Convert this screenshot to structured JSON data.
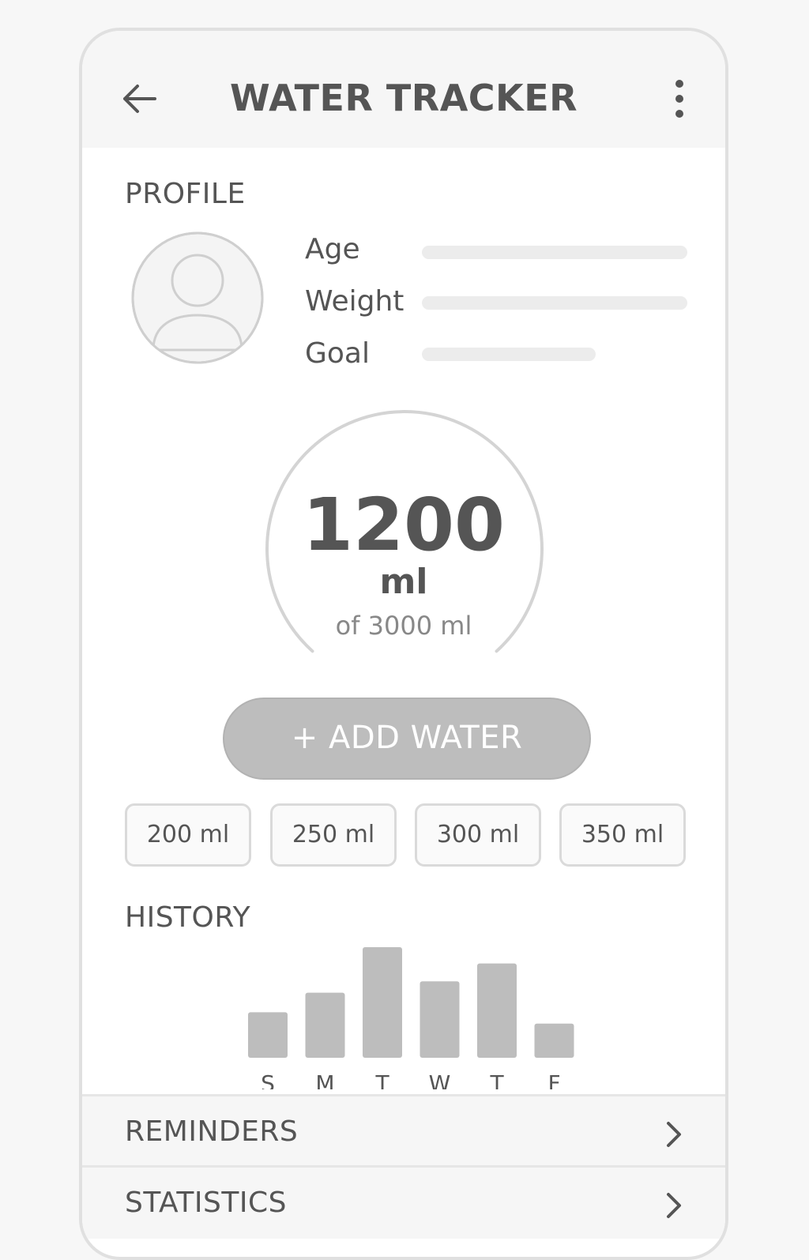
{
  "header": {
    "title": "WATER TRACKER",
    "back_icon": "arrow-left-icon",
    "menu_icon": "more-vertical-icon"
  },
  "profile": {
    "label": "PROFILE",
    "avatar_icon": "user-avatar-icon",
    "fields": [
      {
        "label": "Age"
      },
      {
        "label": "Weight"
      },
      {
        "label": "Goal"
      }
    ]
  },
  "intake": {
    "value": "1200",
    "unit": "ml",
    "goal_text": "of 3000 ml"
  },
  "add_button": {
    "label": "+ ADD WATER"
  },
  "quick_amounts": [
    "200 ml",
    "250 ml",
    "300 ml",
    "350 ml"
  ],
  "history": {
    "label": "HISTORY"
  },
  "chart_data": {
    "type": "bar",
    "categories": [
      "S",
      "M",
      "T",
      "W",
      "T",
      "F"
    ],
    "values": [
      1400,
      2000,
      3400,
      2350,
      2900,
      1050
    ],
    "title": "",
    "xlabel": "",
    "ylabel": ""
  },
  "menu_rows": [
    {
      "label": "REMINDERS",
      "icon": "chevron-right-icon"
    },
    {
      "label": "STATISTICS",
      "icon": "chevron-right-icon"
    }
  ],
  "colors": {
    "text": "#555555",
    "muted": "#888888",
    "bar": "#bdbdbd",
    "border": "#dadada",
    "background": "#ffffff"
  }
}
